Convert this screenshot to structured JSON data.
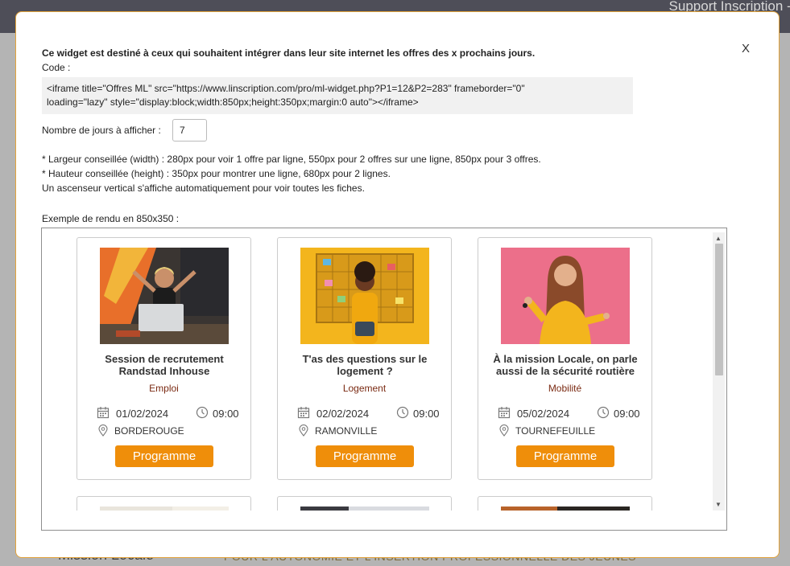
{
  "background": {
    "topbar_title": "Support Inscription - ML",
    "footer_left": "Mission Locale",
    "footer_right": "POUR L'AUTONOMIE ET L'INSERTION PROFESSIONNELLE DES JEUNES"
  },
  "modal": {
    "close_label": "X",
    "intro": "Ce widget est destiné à ceux qui souhaitent intégrer dans leur site internet les offres des x prochains jours.",
    "code_label": "Code :",
    "code_line1": "<iframe title=\"Offres ML\" src=\"https://www.linscription.com/pro/ml-widget.php?P1=12&P2=283\" frameborder=\"0\"",
    "code_line2": "loading=\"lazy\" style=\"display:block;width:850px;height:350px;margin:0 auto\"></iframe>",
    "days_label": "Nombre de jours à afficher :",
    "days_value": "7",
    "hint_width": "* Largeur conseillée (width) : 280px pour voir 1 offre par ligne, 550px pour 2 offres sur une ligne, 850px pour 3 offres.",
    "hint_height": "* Hauteur conseillée (height) : 350px pour montrer une ligne, 680px pour 2 lignes.",
    "hint_scroll": "Un ascenseur vertical s'affiche automatiquement pour voir toutes les fiches.",
    "example_label": "Exemple de rendu en 850x350 :"
  },
  "cards": [
    {
      "title": "Session de recrutement Randstad Inhouse",
      "category": "Emploi",
      "date": "01/02/2024",
      "time": "09:00",
      "location": "BORDEROUGE",
      "button": "Programme"
    },
    {
      "title": "T'as des questions sur le logement ?",
      "category": "Logement",
      "date": "02/02/2024",
      "time": "09:00",
      "location": "RAMONVILLE",
      "button": "Programme"
    },
    {
      "title": "À la mission Locale, on parle aussi de la sécurité routière",
      "category": "Mobilité",
      "date": "05/02/2024",
      "time": "09:00",
      "location": "TOURNEFEUILLE",
      "button": "Programme"
    }
  ],
  "colors": {
    "accent": "#ef8e0a",
    "modal_border": "#e2a23a",
    "category": "#7a2a12"
  },
  "icons": {
    "date": "calendar-icon",
    "time": "clock-icon",
    "location": "location-pin-icon"
  }
}
